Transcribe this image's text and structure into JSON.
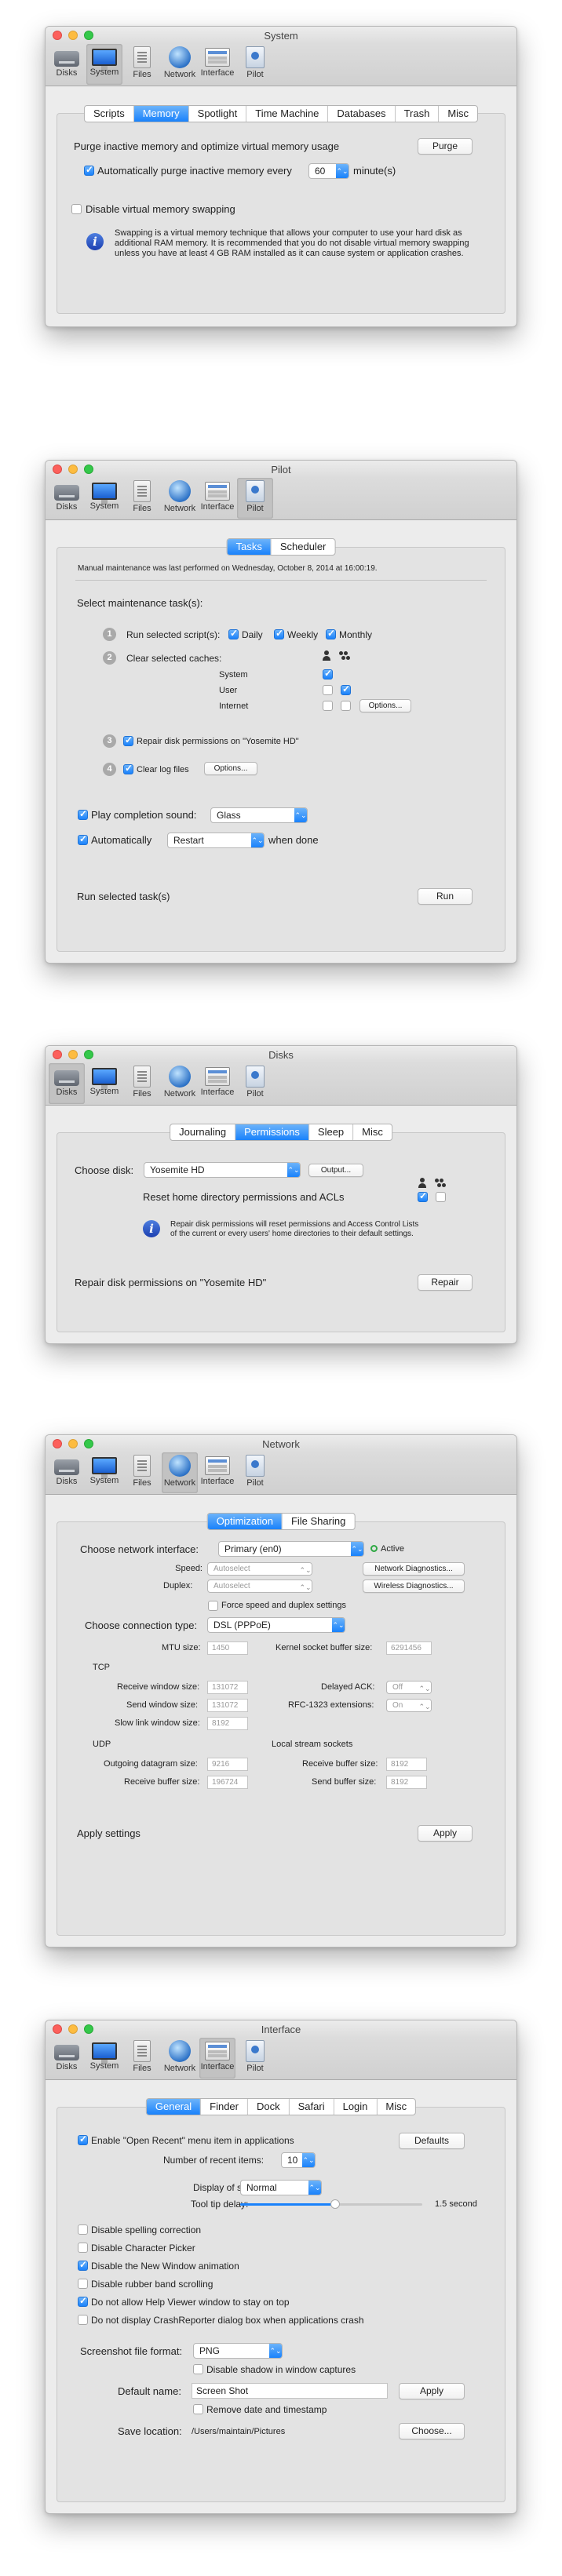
{
  "toolbar": {
    "disks": "Disks",
    "system": "System",
    "files": "Files",
    "network": "Network",
    "interface": "Interface",
    "pilot": "Pilot"
  },
  "system": {
    "title": "System",
    "tabs": [
      "Scripts",
      "Memory",
      "Spotlight",
      "Time Machine",
      "Databases",
      "Trash",
      "Misc"
    ],
    "purge_label": "Purge inactive memory and optimize virtual memory usage",
    "purge_button": "Purge",
    "auto_purge_label": "Automatically purge inactive memory every",
    "auto_purge_value": "60",
    "auto_purge_unit": "minute(s)",
    "disable_swap_label": "Disable virtual memory swapping",
    "info_line1": "Swapping is a virtual memory technique that allows your computer to use your hard disk as",
    "info_line2": "additional RAM memory. It is recommended that you do not disable virtual memory swapping",
    "info_line3": "unless you have at least 4 GB RAM installed as it can cause system or application crashes."
  },
  "pilot": {
    "title": "Pilot",
    "tabs": [
      "Tasks",
      "Scheduler"
    ],
    "last_run": "Manual maintenance was last performed on Wednesday, October 8, 2014 at 16:00:19.",
    "select_label": "Select maintenance task(s):",
    "run_scripts": "Run selected script(s):",
    "daily": "Daily",
    "weekly": "Weekly",
    "monthly": "Monthly",
    "clear_caches": "Clear selected caches:",
    "cache_system": "System",
    "cache_user": "User",
    "cache_internet": "Internet",
    "options_button": "Options...",
    "repair_perm": "Repair disk permissions on \"Yosemite HD\"",
    "clear_logs": "Clear log files",
    "options_button2": "Options...",
    "play_sound": "Play completion sound:",
    "sound_value": "Glass",
    "automatically": "Automatically",
    "restart_value": "Restart",
    "when_done": "when done",
    "run_label": "Run selected task(s)",
    "run_button": "Run",
    "n1": "1",
    "n2": "2",
    "n3": "3",
    "n4": "4"
  },
  "disks": {
    "title": "Disks",
    "tabs": [
      "Journaling",
      "Permissions",
      "Sleep",
      "Misc"
    ],
    "choose_disk": "Choose disk:",
    "disk_value": "Yosemite HD",
    "output_button": "Output...",
    "reset_label": "Reset home directory permissions and ACLs",
    "info_line1": "Repair disk permissions will reset permissions and Access Control Lists",
    "info_line2": "of the current or every users' home directories to their default settings.",
    "repair_label": "Repair disk permissions on \"Yosemite HD\"",
    "repair_button": "Repair"
  },
  "network": {
    "title": "Network",
    "tabs": [
      "Optimization",
      "File Sharing"
    ],
    "choose_iface": "Choose network interface:",
    "iface_value": "Primary (en0)",
    "active": "Active",
    "speed": "Speed:",
    "speed_value": "Autoselect",
    "duplex": "Duplex:",
    "duplex_value": "Autoselect",
    "diag_button": "Network Diagnostics...",
    "wdiag_button": "Wireless Diagnostics...",
    "force_label": "Force speed and duplex settings",
    "conn_type": "Choose connection type:",
    "conn_value": "DSL (PPPoE)",
    "mtu": "MTU size:",
    "mtu_value": "1450",
    "kernel_buf": "Kernel socket buffer size:",
    "kernel_value": "6291456",
    "tcp": "TCP",
    "recv_win": "Receive window size:",
    "recv_win_value": "131072",
    "delayed_ack": "Delayed ACK:",
    "delayed_ack_value": "Off",
    "send_win": "Send window size:",
    "send_win_value": "131072",
    "rfc": "RFC-1323 extensions:",
    "rfc_value": "On",
    "slow_link": "Slow link window size:",
    "slow_link_value": "8192",
    "udp": "UDP",
    "local_stream": "Local stream sockets",
    "out_dgram": "Outgoing datagram size:",
    "out_dgram_value": "9216",
    "recv_buf": "Receive buffer size:",
    "recv_buf_value": "196724",
    "ls_recv": "Receive buffer size:",
    "ls_recv_value": "8192",
    "ls_send": "Send buffer size:",
    "ls_send_value": "8192",
    "apply_label": "Apply settings",
    "apply_button": "Apply"
  },
  "interface": {
    "title": "Interface",
    "tabs": [
      "General",
      "Finder",
      "Dock",
      "Safari",
      "Login",
      "Misc"
    ],
    "open_recent": "Enable \"Open Recent\" menu item in applications",
    "defaults_button": "Defaults",
    "num_recent": "Number of recent items:",
    "num_recent_value": "10",
    "display_sheets": "Display of sheets:",
    "sheets_value": "Normal",
    "tooltip_delay": "Tool tip delay:",
    "tooltip_value": "1.5 second",
    "tooltip_fraction": 0.52,
    "opt1": "Disable spelling correction",
    "opt2": "Disable Character Picker",
    "opt3": "Disable the New Window animation",
    "opt4": "Disable rubber band scrolling",
    "opt5": "Do not allow Help Viewer window to stay on top",
    "opt6": "Do not display CrashReporter dialog box when applications crash",
    "shot_format": "Screenshot file format:",
    "shot_format_value": "PNG",
    "disable_shadow": "Disable shadow in window captures",
    "default_name": "Default name:",
    "default_name_value": "Screen Shot",
    "apply_button": "Apply",
    "remove_date": "Remove date and timestamp",
    "save_location": "Save location:",
    "save_path": "/Users/maintain/Pictures",
    "choose_button": "Choose..."
  }
}
